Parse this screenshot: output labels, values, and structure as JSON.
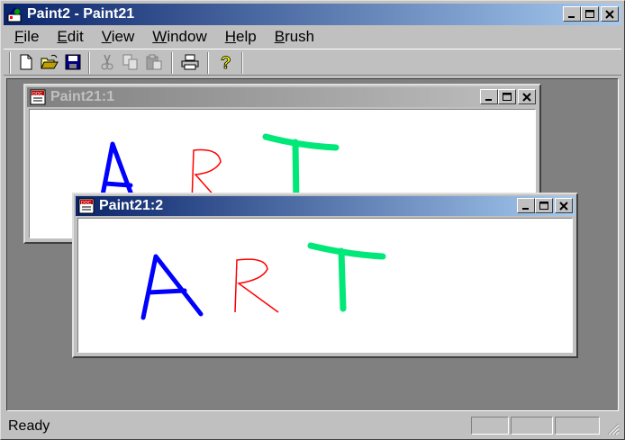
{
  "window": {
    "title": "Paint2 - Paint21",
    "icon": "paint-app-icon"
  },
  "caption_buttons": {
    "minimize": "minimize-icon",
    "maximize": "maximize-icon",
    "close": "close-icon"
  },
  "menu": [
    {
      "label": "File",
      "accel": "F",
      "rest": "ile"
    },
    {
      "label": "Edit",
      "accel": "E",
      "rest": "dit"
    },
    {
      "label": "View",
      "accel": "V",
      "rest": "iew"
    },
    {
      "label": "Window",
      "accel": "W",
      "rest": "indow"
    },
    {
      "label": "Help",
      "accel": "H",
      "rest": "elp"
    },
    {
      "label": "Brush",
      "accel": "B",
      "rest": "rush"
    }
  ],
  "toolbar": {
    "buttons": [
      "new-icon",
      "open-icon",
      "save-icon",
      "cut-icon",
      "copy-icon",
      "paste-icon",
      "print-icon",
      "help-icon"
    ]
  },
  "documents": [
    {
      "title": "Paint21:1",
      "state": "inactive",
      "drawing_text": "ART"
    },
    {
      "title": "Paint21:2",
      "state": "active",
      "drawing_text": "ART"
    }
  ],
  "colors": {
    "letter_a": "#0000ff",
    "letter_r": "#ff0000",
    "letter_t": "#00ff80",
    "title_active": "#0a246a",
    "face": "#c0c0c0",
    "mdi_bg": "#808080"
  },
  "status": {
    "text": "Ready"
  }
}
